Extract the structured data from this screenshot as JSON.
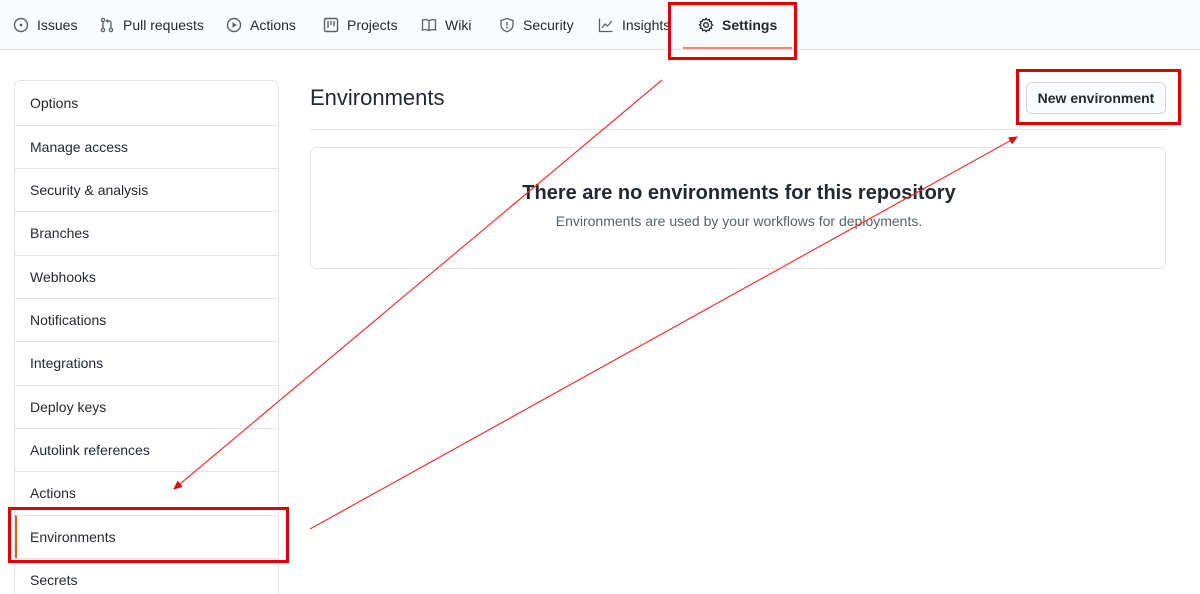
{
  "nav": {
    "tabs": [
      {
        "label": "Issues",
        "icon": "issue-opened-icon"
      },
      {
        "label": "Pull requests",
        "icon": "git-pull-request-icon"
      },
      {
        "label": "Actions",
        "icon": "play-icon"
      },
      {
        "label": "Projects",
        "icon": "project-icon"
      },
      {
        "label": "Wiki",
        "icon": "book-icon"
      },
      {
        "label": "Security",
        "icon": "shield-icon"
      },
      {
        "label": "Insights",
        "icon": "graph-icon"
      },
      {
        "label": "Settings",
        "icon": "gear-icon",
        "selected": true
      }
    ]
  },
  "sidebar": {
    "items": [
      {
        "label": "Options"
      },
      {
        "label": "Manage access"
      },
      {
        "label": "Security & analysis"
      },
      {
        "label": "Branches"
      },
      {
        "label": "Webhooks"
      },
      {
        "label": "Notifications"
      },
      {
        "label": "Integrations"
      },
      {
        "label": "Deploy keys"
      },
      {
        "label": "Autolink references"
      },
      {
        "label": "Actions"
      },
      {
        "label": "Environments",
        "selected": true
      },
      {
        "label": "Secrets"
      }
    ]
  },
  "main": {
    "title": "Environments",
    "new_button_label": "New environment",
    "empty_title": "There are no environments for this repository",
    "empty_description": "Environments are used by your workflows for deployments."
  },
  "colors": {
    "annotation": "#e00000",
    "selected_underline": "#f9826c",
    "sidebar_selected_border": "#e36209",
    "arrow": "#ee3333"
  }
}
